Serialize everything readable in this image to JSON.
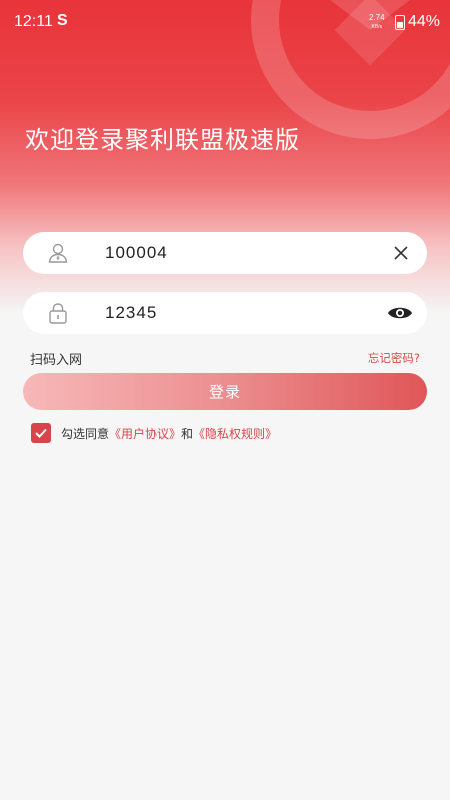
{
  "status": {
    "time": "12:11",
    "app_icon": "S",
    "net_speed": "2.74",
    "net_unit": "KB/s",
    "battery": "44%"
  },
  "title": "欢迎登录聚利联盟极速版",
  "username": {
    "value": "100004",
    "icon": "user-icon",
    "action_icon": "clear-icon"
  },
  "password": {
    "value": "12345",
    "icon": "lock-icon",
    "action_icon": "eye-icon"
  },
  "scan_label": "扫码入网",
  "forgot_label": "忘记密码?",
  "login_label": "登录",
  "agreement": {
    "checked": true,
    "prefix": "勾选同意",
    "user_agreement": "《用户协议》",
    "and": "和",
    "privacy": "《隐私权规则》"
  },
  "colors": {
    "accent": "#d94449",
    "hero": "#e8343a"
  }
}
